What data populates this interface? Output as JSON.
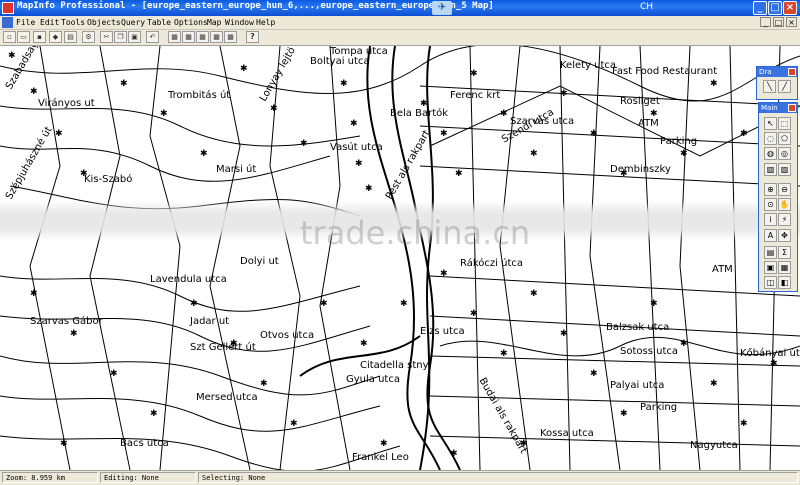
{
  "window": {
    "title": "MapInfo Professional - [europe_eastern_europe_hun_6,...,europe_eastern_europe_hun_5 Map]",
    "lang_indicator": "CH",
    "controls": {
      "minimize": "_",
      "maximize": "□",
      "close": "×"
    }
  },
  "menubar": {
    "items": [
      "File",
      "Edit",
      "Tools",
      "Objects",
      "Query",
      "Table",
      "Options",
      "Map",
      "Window",
      "Help"
    ],
    "mdi_controls": {
      "minimize": "_",
      "restore": "□",
      "close": "×"
    }
  },
  "toolbar": {
    "icons": [
      "new-icon",
      "open-icon",
      "save-icon",
      "save-workspace-icon",
      "print-icon",
      "cut-icon",
      "copy-icon",
      "paste-icon",
      "undo-icon",
      "new-browser-icon",
      "new-map-icon",
      "new-graph-icon",
      "new-layout-icon",
      "new-redistrict-icon"
    ],
    "help_label": "?"
  },
  "map": {
    "watermark": "trade.china.cn",
    "labels": [
      {
        "text": "Szabadsag hegy",
        "rot": "r"
      },
      {
        "text": "Virányos ut",
        "rot": ""
      },
      {
        "text": "Trombitás út",
        "rot": ""
      },
      {
        "text": "Szépjuhászné út",
        "rot": "r"
      },
      {
        "text": "Lonyay lejtö",
        "rot": "r"
      },
      {
        "text": "Boltyai utca",
        "rot": ""
      },
      {
        "text": "Tompa utca",
        "rot": ""
      },
      {
        "text": "Vasút utca",
        "rot": ""
      },
      {
        "text": "Ferenc krt",
        "rot": ""
      },
      {
        "text": "Szarvas utca",
        "rot": ""
      },
      {
        "text": "Dembinszky",
        "rot": ""
      },
      {
        "text": "Parking",
        "rot": ""
      },
      {
        "text": "ATM",
        "rot": ""
      },
      {
        "text": "Fast Food Restaurant",
        "rot": ""
      },
      {
        "text": "Rosliget",
        "rot": ""
      },
      {
        "text": "Kelety utca",
        "rot": ""
      },
      {
        "text": "Kis-Szabó",
        "rot": ""
      },
      {
        "text": "Marsi út",
        "rot": ""
      },
      {
        "text": "Pest als rakpart",
        "rot": "r"
      },
      {
        "text": "Szendi utca",
        "rot": "r3"
      },
      {
        "text": "Bela Bartók",
        "rot": ""
      },
      {
        "text": "Rákóczi útca",
        "rot": ""
      },
      {
        "text": "Lavendula utca",
        "rot": ""
      },
      {
        "text": "Dolyi ut",
        "rot": ""
      },
      {
        "text": "Szarvas Gábor",
        "rot": ""
      },
      {
        "text": "Jadar ut",
        "rot": ""
      },
      {
        "text": "Szt Gellért út",
        "rot": ""
      },
      {
        "text": "Otvos utca",
        "rot": ""
      },
      {
        "text": "Citadella stny",
        "rot": ""
      },
      {
        "text": "Gyula utca",
        "rot": ""
      },
      {
        "text": "Elzs utca",
        "rot": ""
      },
      {
        "text": "Balzsak utca",
        "rot": ""
      },
      {
        "text": "Sotoss utca",
        "rot": ""
      },
      {
        "text": "Kőbányai út",
        "rot": ""
      },
      {
        "text": "Parking",
        "rot": ""
      },
      {
        "text": "Mersed utca",
        "rot": ""
      },
      {
        "text": "Frankel Leo",
        "rot": ""
      },
      {
        "text": "Budai als rakpart",
        "rot": "r2"
      },
      {
        "text": "Palyai utca",
        "rot": ""
      },
      {
        "text": "ATM",
        "rot": ""
      },
      {
        "text": "Bacs utca",
        "rot": ""
      },
      {
        "text": "Kossa utca",
        "rot": ""
      },
      {
        "text": "Nagyutca",
        "rot": ""
      }
    ]
  },
  "palette_drawing": {
    "title": "Dra"
  },
  "palette_main": {
    "title": "Main"
  },
  "statusbar": {
    "zoom": "Zoom: 8.959 km",
    "editing": "Editing: None",
    "selecting": "Selecting: None"
  }
}
